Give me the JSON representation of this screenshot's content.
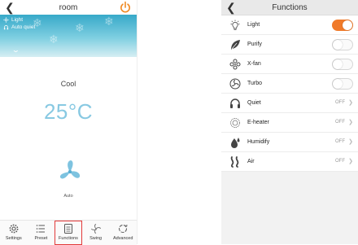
{
  "left": {
    "title": "room",
    "status_light": "Light",
    "status_mode": "Auto quiet",
    "mode": "Cool",
    "temperature": "25°C",
    "fan_speed": "Auto",
    "tabs": [
      {
        "label": "Settings",
        "icon": "gear-icon",
        "active": false
      },
      {
        "label": "Preset",
        "icon": "list-icon",
        "active": false
      },
      {
        "label": "Functions",
        "icon": "functions-icon",
        "active": true
      },
      {
        "label": "Swing",
        "icon": "swing-icon",
        "active": false
      },
      {
        "label": "Advanced",
        "icon": "advanced-icon",
        "active": false
      }
    ],
    "colors": {
      "power": "#f08a24",
      "temperature": "#88c9e2",
      "active_outline": "#e23a3a"
    }
  },
  "right": {
    "title": "Functions",
    "items": [
      {
        "label": "Light",
        "icon": "light-icon",
        "control": "toggle",
        "on": true
      },
      {
        "label": "Purify",
        "icon": "leaf-icon",
        "control": "toggle",
        "on": false
      },
      {
        "label": "X-fan",
        "icon": "x-fan-icon",
        "control": "toggle",
        "on": false
      },
      {
        "label": "Turbo",
        "icon": "turbo-icon",
        "control": "toggle",
        "on": false
      },
      {
        "label": "Quiet",
        "icon": "headphones-icon",
        "control": "value",
        "value": "OFF"
      },
      {
        "label": "E-heater",
        "icon": "heater-icon",
        "control": "value",
        "value": "OFF"
      },
      {
        "label": "Humidify",
        "icon": "humidify-icon",
        "control": "value",
        "value": "OFF"
      },
      {
        "label": "Air",
        "icon": "air-icon",
        "control": "value",
        "value": "OFF"
      }
    ],
    "colors": {
      "toggle_on": "#f07a2a"
    }
  }
}
